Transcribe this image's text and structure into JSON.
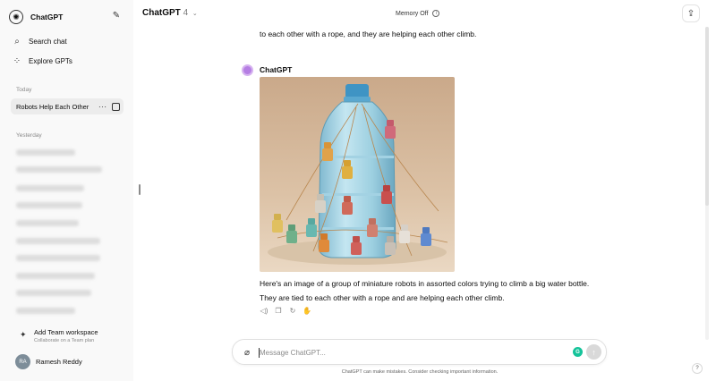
{
  "sidebar": {
    "title": "ChatGPT",
    "links": [
      {
        "label": "Search chat",
        "icon": "search-icon"
      },
      {
        "label": "Explore GPTs",
        "icon": "grid-icon"
      }
    ],
    "section_today": "Today",
    "active_chat": "Robots Help Each Other",
    "section_yesterday": "Yesterday",
    "team": {
      "title": "Add Team workspace",
      "subtitle": "Collaborate on a Team plan"
    },
    "user": {
      "initials": "RA",
      "name": "Ramesh Reddy"
    }
  },
  "header": {
    "model": "ChatGPT",
    "version": "4",
    "memory": "Memory Off"
  },
  "chat": {
    "previous_line": "to each other with a rope, and they are helping each other climb.",
    "bot_name": "ChatGPT",
    "reply_lines": [
      "Here's an image of a group of miniature robots in assorted colors trying to climb a big water bottle.",
      "They are tied to each other with a rope and are helping each other climb."
    ]
  },
  "composer": {
    "placeholder": "Message ChatGPT..."
  },
  "footer": {
    "disclaimer": "ChatGPT can make mistakes. Consider checking important information.",
    "help": "?"
  }
}
